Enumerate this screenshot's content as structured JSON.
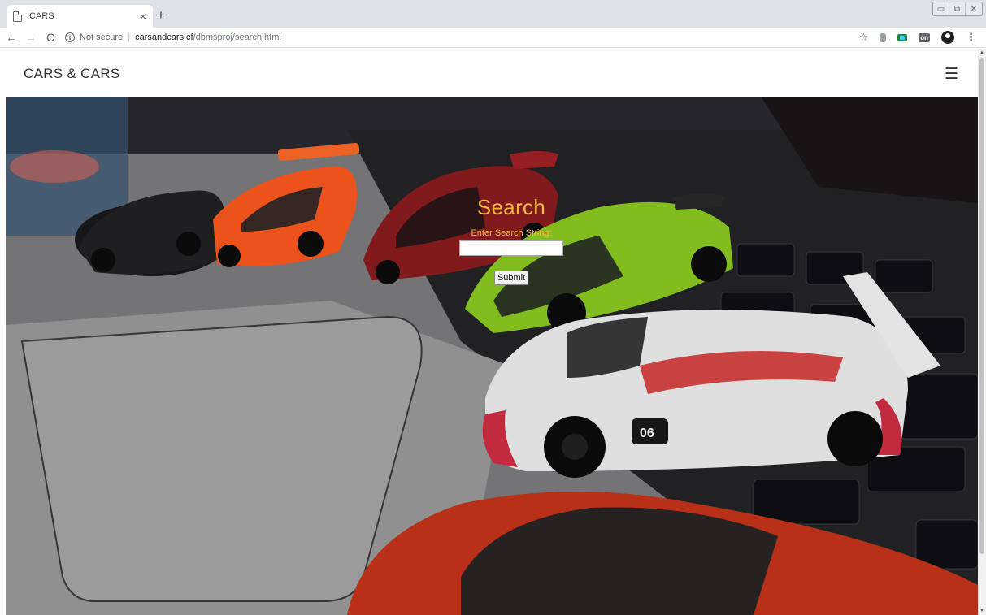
{
  "browser": {
    "tab_title": "CARS",
    "tab_close": "×",
    "new_tab": "+",
    "window_controls": [
      "▭",
      "⧉",
      "✕"
    ],
    "back": "←",
    "forward": "→",
    "reload": "C",
    "info": "i",
    "security_text": "Not secure",
    "separator": "|",
    "url_host": "carsandcars.cf",
    "url_path": "/dbmsproj/search.html",
    "star": "☆",
    "ext_on_label": "on",
    "menu": "⋮"
  },
  "site": {
    "brand": "CARS & CARS",
    "menu_icon": "☰"
  },
  "search": {
    "title": "Search",
    "label": "Enter Search String:",
    "input_value": "",
    "submit_label": "Submit"
  },
  "colors": {
    "accent": "#f4b942"
  },
  "scrollbar": {
    "up": "▲",
    "down": "▼"
  }
}
